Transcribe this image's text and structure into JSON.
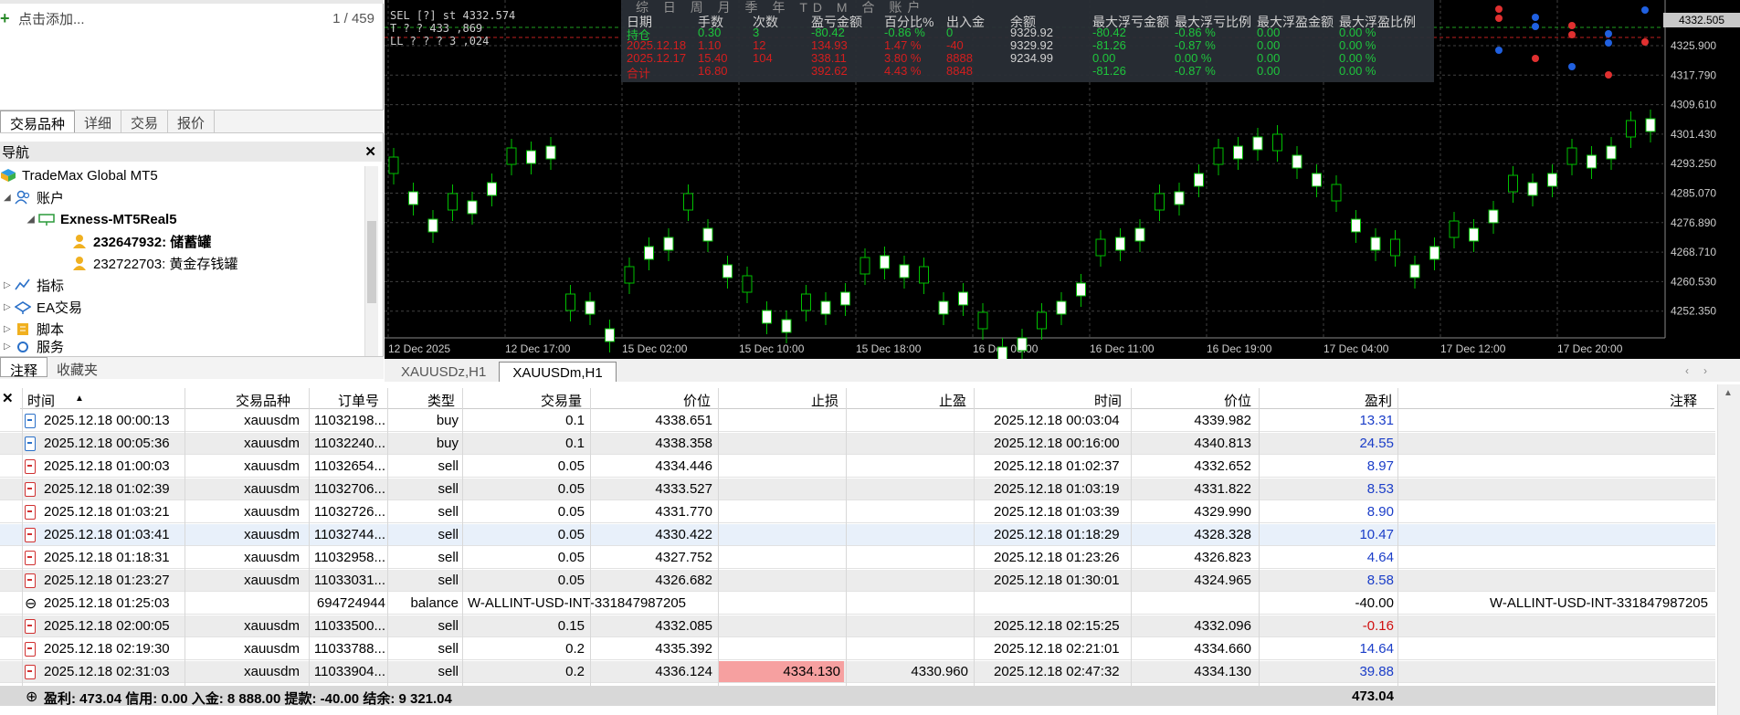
{
  "marketwatch": {
    "add_label": "点击添加...",
    "count": "1 / 459"
  },
  "left_tabs": [
    "交易品种",
    "详细",
    "交易",
    "报价"
  ],
  "navigator": {
    "title": "导航",
    "items": [
      {
        "label": "TradeMax Global MT5"
      },
      {
        "label": "账户"
      },
      {
        "label": "Exness-MT5Real5"
      },
      {
        "label": "232647932: 储蓄罐"
      },
      {
        "label": "232722703: 黄金存钱罐"
      },
      {
        "label": "指标"
      },
      {
        "label": "EA交易"
      },
      {
        "label": "脚本"
      },
      {
        "label": "服务"
      }
    ]
  },
  "bottom_left_tabs": [
    "注释",
    "收藏夹"
  ],
  "chart": {
    "header_lines": [
      "SEL  [?]  st 4332.574",
      "T   ?  ?  433 ,869",
      "LL ?  ?  ?  3 ,024"
    ],
    "price_axis": [
      "4325.900",
      "4317.790",
      "4309.610",
      "4301.430",
      "4293.250",
      "4285.070",
      "4276.890",
      "4268.710",
      "4260.530",
      "4252.350"
    ],
    "current_price": "4332.505",
    "time_axis": [
      "12 Dec 2025",
      "12 Dec 17:00",
      "15 Dec 02:00",
      "15 Dec 10:00",
      "15 Dec 18:00",
      "16 Dec 03:00",
      "16 Dec 11:00",
      "16 Dec 19:00",
      "17 Dec 04:00",
      "17 Dec 12:00",
      "17 Dec 20:00"
    ],
    "tabs": [
      "XAUUSDz,H1",
      "XAUUSDm,H1"
    ],
    "active_tab": 1,
    "colors": {
      "bull": "#00c000",
      "bear": "#ffffff",
      "bg": "#000000",
      "grid": "#404040"
    }
  },
  "overlay": {
    "title": "综 日 周 月 季 年 TD M 合 账户",
    "headers": [
      "日期",
      "手数",
      "次数",
      "盈亏金额",
      "百分比%",
      "出入金",
      "余额",
      "最大浮亏金额",
      "最大浮亏比例",
      "最大浮盈金额",
      "最大浮盈比例"
    ],
    "rows": [
      [
        "持仓",
        "0.30",
        "3",
        "-80.42",
        "-0.86 %",
        "0",
        "9329.92",
        "-80.42",
        "-0.86 %",
        "0.00",
        "0.00 %"
      ],
      [
        "2025.12.18",
        "1.10",
        "12",
        "134.93",
        "1.47 %",
        "-40",
        "9329.92",
        "-81.26",
        "-0.87 %",
        "0.00",
        "0.00 %"
      ],
      [
        "2025.12.17",
        "15.40",
        "104",
        "338.11",
        "3.80 %",
        "8888",
        "9234.99",
        "0.00",
        "0.00 %",
        "0.00",
        "0.00 %"
      ],
      [
        "合计",
        "16.80",
        "",
        "392.62",
        "4.43 %",
        "8848",
        "",
        "-81.26",
        "-0.87 %",
        "0.00",
        "0.00 %"
      ]
    ]
  },
  "table": {
    "headers": [
      "时间",
      "交易品种",
      "订单号",
      "类型",
      "交易量",
      "价位",
      "止损",
      "止盈",
      "时间",
      "价位",
      "盈利",
      "注释"
    ],
    "rows": [
      {
        "t1": "2025.12.18 00:00:13",
        "sym": "xauusdm",
        "order": "11032198...",
        "type": "buy",
        "vol": "0.1",
        "p1": "4338.651",
        "sl": "",
        "tp": "",
        "t2": "2025.12.18 00:03:04",
        "p2": "4339.982",
        "profit": "13.31",
        "note": "",
        "kind": "buy"
      },
      {
        "t1": "2025.12.18 00:05:36",
        "sym": "xauusdm",
        "order": "11032240...",
        "type": "buy",
        "vol": "0.1",
        "p1": "4338.358",
        "sl": "",
        "tp": "",
        "t2": "2025.12.18 00:16:00",
        "p2": "4340.813",
        "profit": "24.55",
        "note": "",
        "kind": "buy"
      },
      {
        "t1": "2025.12.18 01:00:03",
        "sym": "xauusdm",
        "order": "11032654...",
        "type": "sell",
        "vol": "0.05",
        "p1": "4334.446",
        "sl": "",
        "tp": "",
        "t2": "2025.12.18 01:02:37",
        "p2": "4332.652",
        "profit": "8.97",
        "note": "",
        "kind": "sell"
      },
      {
        "t1": "2025.12.18 01:02:39",
        "sym": "xauusdm",
        "order": "11032706...",
        "type": "sell",
        "vol": "0.05",
        "p1": "4333.527",
        "sl": "",
        "tp": "",
        "t2": "2025.12.18 01:03:19",
        "p2": "4331.822",
        "profit": "8.53",
        "note": "",
        "kind": "sell"
      },
      {
        "t1": "2025.12.18 01:03:21",
        "sym": "xauusdm",
        "order": "11032726...",
        "type": "sell",
        "vol": "0.05",
        "p1": "4331.770",
        "sl": "",
        "tp": "",
        "t2": "2025.12.18 01:03:39",
        "p2": "4329.990",
        "profit": "8.90",
        "note": "",
        "kind": "sell"
      },
      {
        "t1": "2025.12.18 01:03:41",
        "sym": "xauusdm",
        "order": "11032744...",
        "type": "sell",
        "vol": "0.05",
        "p1": "4330.422",
        "sl": "",
        "tp": "",
        "t2": "2025.12.18 01:18:29",
        "p2": "4328.328",
        "profit": "10.47",
        "note": "",
        "kind": "sell"
      },
      {
        "t1": "2025.12.18 01:18:31",
        "sym": "xauusdm",
        "order": "11032958...",
        "type": "sell",
        "vol": "0.05",
        "p1": "4327.752",
        "sl": "",
        "tp": "",
        "t2": "2025.12.18 01:23:26",
        "p2": "4326.823",
        "profit": "4.64",
        "note": "",
        "kind": "sell"
      },
      {
        "t1": "2025.12.18 01:23:27",
        "sym": "xauusdm",
        "order": "11033031...",
        "type": "sell",
        "vol": "0.05",
        "p1": "4326.682",
        "sl": "",
        "tp": "",
        "t2": "2025.12.18 01:30:01",
        "p2": "4324.965",
        "profit": "8.58",
        "note": "",
        "kind": "sell"
      },
      {
        "t1": "2025.12.18 01:25:03",
        "sym": "",
        "order": "694724944",
        "type": "balance",
        "vol": "W-ALLINT-USD-INT-331847987205",
        "p1": "",
        "sl": "",
        "tp": "",
        "t2": "",
        "p2": "",
        "profit": "-40.00",
        "note": "W-ALLINT-USD-INT-331847987205",
        "kind": "balance"
      },
      {
        "t1": "2025.12.18 02:00:05",
        "sym": "xauusdm",
        "order": "11033500...",
        "type": "sell",
        "vol": "0.15",
        "p1": "4332.085",
        "sl": "",
        "tp": "",
        "t2": "2025.12.18 02:15:25",
        "p2": "4332.096",
        "profit": "-0.16",
        "note": "",
        "kind": "sell"
      },
      {
        "t1": "2025.12.18 02:19:30",
        "sym": "xauusdm",
        "order": "11033788...",
        "type": "sell",
        "vol": "0.2",
        "p1": "4335.392",
        "sl": "",
        "tp": "",
        "t2": "2025.12.18 02:21:01",
        "p2": "4334.660",
        "profit": "14.64",
        "note": "",
        "kind": "sell"
      },
      {
        "t1": "2025.12.18 02:31:03",
        "sym": "xauusdm",
        "order": "11033904...",
        "type": "sell",
        "vol": "0.2",
        "p1": "4336.124",
        "sl": "4334.130",
        "tp": "4330.960",
        "t2": "2025.12.18 02:47:32",
        "p2": "4334.130",
        "profit": "39.88",
        "note": "",
        "kind": "sell"
      }
    ],
    "footer": {
      "summary": "盈利: 473.04  信用: 0.00  入金: 8 888.00  提款: -40.00  结余: 9 321.04",
      "total": "473.04"
    }
  }
}
